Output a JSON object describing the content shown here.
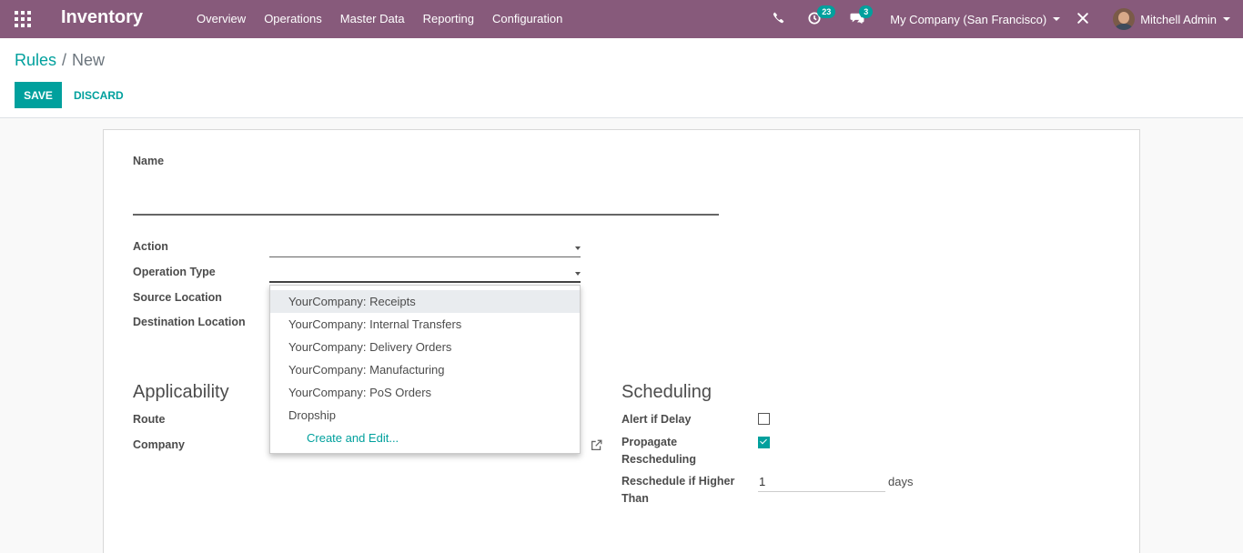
{
  "navbar": {
    "brand": "Inventory",
    "menu": [
      "Overview",
      "Operations",
      "Master Data",
      "Reporting",
      "Configuration"
    ],
    "activity_badge": "23",
    "messages_badge": "3",
    "company": "My Company (San Francisco)",
    "user": "Mitchell Admin"
  },
  "breadcrumb": {
    "parent": "Rules",
    "separator": "/",
    "current": "New"
  },
  "buttons": {
    "save": "Save",
    "discard": "DISCARD"
  },
  "form": {
    "name_label": "Name",
    "action_label": "Action",
    "operation_type_label": "Operation Type",
    "source_location_label": "Source Location",
    "destination_location_label": "Destination Location",
    "applicability_title": "Applicability",
    "route_label": "Route",
    "company_label": "Company",
    "scheduling_title": "Scheduling",
    "alert_if_delay_label": "Alert if Delay",
    "alert_if_delay_checked": false,
    "propagate_label_line1": "Propagate",
    "propagate_label_line2": "Rescheduling",
    "propagate_checked": true,
    "reschedule_label_line1": "Reschedule if Higher",
    "reschedule_label_line2": "Than",
    "reschedule_value": "1",
    "reschedule_unit": "days"
  },
  "dropdown": {
    "options": [
      "YourCompany: Receipts",
      "YourCompany: Internal Transfers",
      "YourCompany: Delivery Orders",
      "YourCompany: Manufacturing",
      "YourCompany: PoS Orders",
      "Dropship"
    ],
    "highlighted_index": 0,
    "create_and_edit": "Create and Edit..."
  },
  "colors": {
    "navbar": "#875a7b",
    "accent": "#00a09d"
  }
}
